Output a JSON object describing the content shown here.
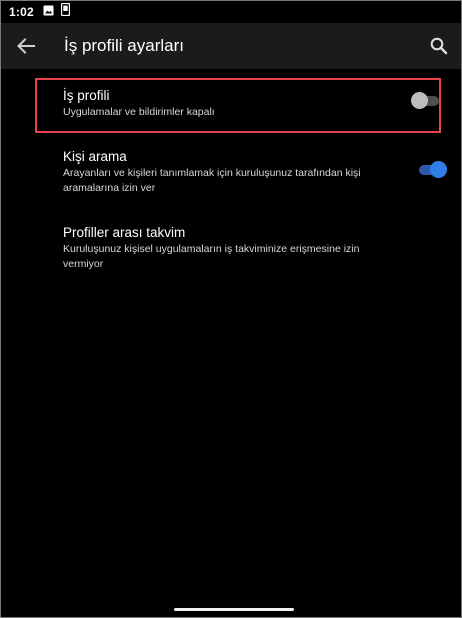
{
  "status_bar": {
    "time": "1:02",
    "icons": [
      "image-icon",
      "phone-device-icon"
    ]
  },
  "app_bar": {
    "title": "İş profili ayarları",
    "back_icon": "arrow-left-icon",
    "search_icon": "search-icon"
  },
  "settings": [
    {
      "title": "İş profili",
      "description": "Uygulamalar ve bildirimler kapalı",
      "toggle": "off",
      "highlighted": true
    },
    {
      "title": "Kişi arama",
      "description": "Arayanları ve kişileri tanımlamak için kuruluşunuz tarafından kişi aramalarına izin ver",
      "toggle": "on"
    },
    {
      "title": "Profiller arası takvim",
      "description": "Kuruluşunuz kişisel uygulamaların iş takviminize erişmesine izin vermiyor"
    }
  ],
  "colors": {
    "background": "#000000",
    "app_bar": "#1b1b1b",
    "highlight": "#e8424a",
    "toggle_on": "#2f7fe8",
    "toggle_off": "#bdbdbd"
  }
}
